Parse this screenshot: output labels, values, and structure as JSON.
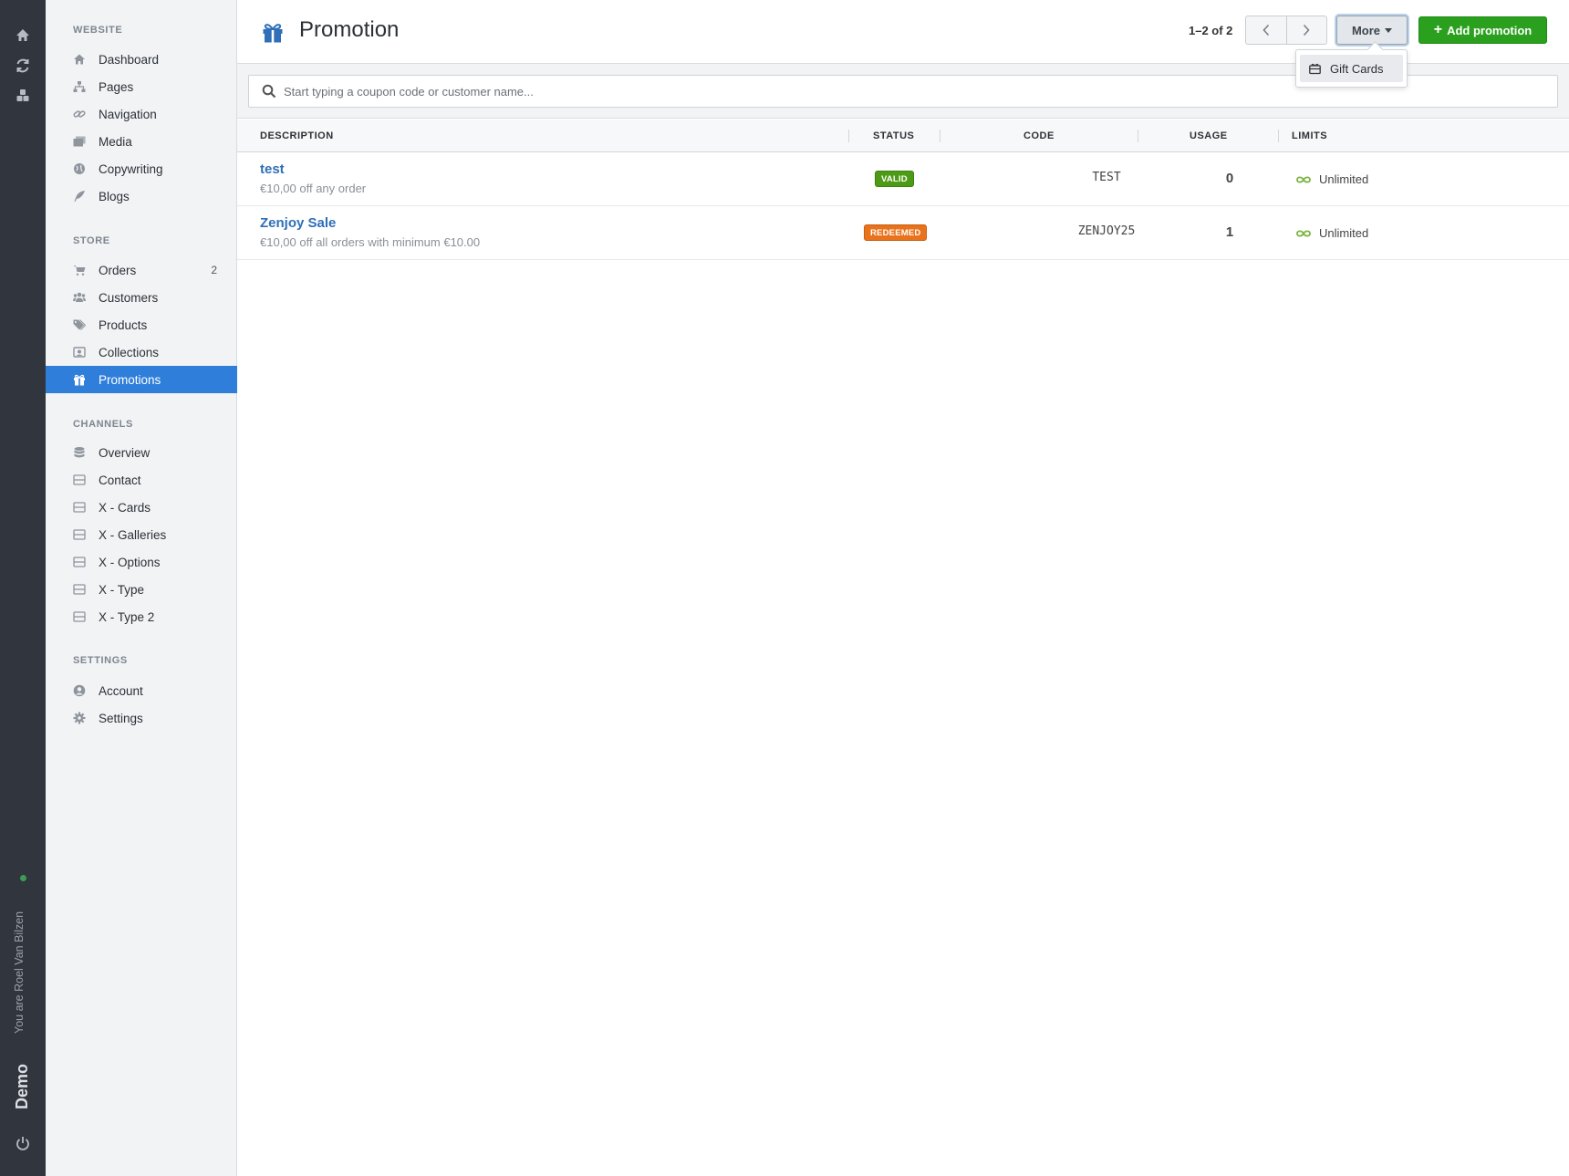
{
  "rail": {
    "user_text": "You are Roel Van Bilzen",
    "workspace": "Demo"
  },
  "sidebar": {
    "sections": [
      {
        "heading": "WEBSITE",
        "items": [
          {
            "label": "Dashboard",
            "icon": "home-icon"
          },
          {
            "label": "Pages",
            "icon": "sitemap-icon"
          },
          {
            "label": "Navigation",
            "icon": "link-icon"
          },
          {
            "label": "Media",
            "icon": "images-icon"
          },
          {
            "label": "Copywriting",
            "icon": "globe-icon"
          },
          {
            "label": "Blogs",
            "icon": "feather-icon"
          }
        ]
      },
      {
        "heading": "STORE",
        "items": [
          {
            "label": "Orders",
            "icon": "cart-icon",
            "count": "2"
          },
          {
            "label": "Customers",
            "icon": "users-icon"
          },
          {
            "label": "Products",
            "icon": "tags-icon"
          },
          {
            "label": "Collections",
            "icon": "collection-icon"
          },
          {
            "label": "Promotions",
            "icon": "gift-icon",
            "active": true
          }
        ]
      },
      {
        "heading": "CHANNELS",
        "items": [
          {
            "label": "Overview",
            "icon": "database-icon"
          },
          {
            "label": "Contact",
            "icon": "channel-icon"
          },
          {
            "label": "X - Cards",
            "icon": "channel-icon"
          },
          {
            "label": "X - Galleries",
            "icon": "channel-icon"
          },
          {
            "label": "X - Options",
            "icon": "channel-icon"
          },
          {
            "label": "X - Type",
            "icon": "channel-icon"
          },
          {
            "label": "X - Type 2",
            "icon": "channel-icon"
          }
        ]
      },
      {
        "heading": "SETTINGS",
        "items": [
          {
            "label": "Account",
            "icon": "user-circle-icon"
          },
          {
            "label": "Settings",
            "icon": "gear-icon"
          }
        ]
      }
    ]
  },
  "header": {
    "title": "Promotion",
    "pager_text": "1–2 of 2",
    "more_label": "More",
    "add_label": "Add promotion",
    "dropdown_items": [
      "Gift Cards"
    ]
  },
  "search": {
    "placeholder": "Start typing a coupon code or customer name..."
  },
  "table": {
    "columns": [
      "DESCRIPTION",
      "STATUS",
      "CODE",
      "USAGE",
      "LIMITS"
    ],
    "rows": [
      {
        "name": "test",
        "description": "€10,00 off any order",
        "status": "VALID",
        "status_kind": "valid",
        "code": "TEST",
        "usage": "0",
        "limit": "Unlimited"
      },
      {
        "name": "Zenjoy Sale",
        "description": "€10,00 off all orders with minimum €10.00",
        "status": "REDEEMED",
        "status_kind": "redeemed",
        "code": "ZENJOY25",
        "usage": "1",
        "limit": "Unlimited"
      }
    ]
  },
  "colors": {
    "accent": "#2f7fda",
    "valid": "#4d9a16",
    "redeemed": "#e8731c",
    "add_button": "#2aa01e"
  }
}
